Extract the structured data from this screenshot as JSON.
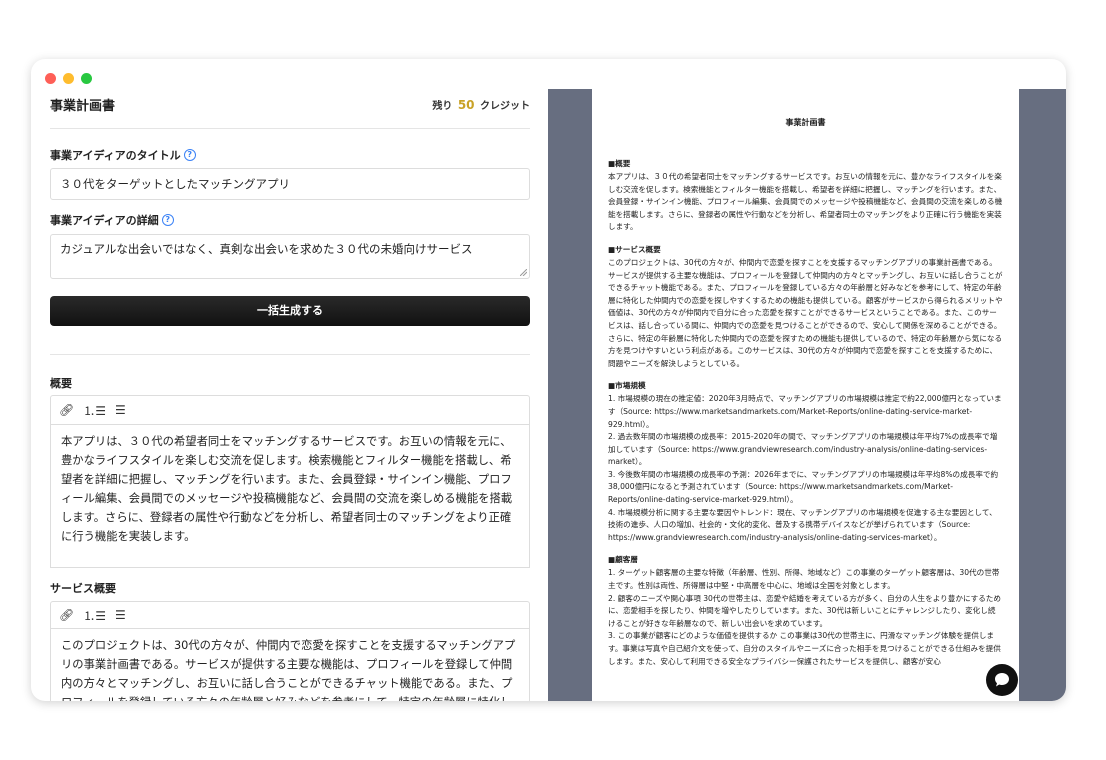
{
  "window": {
    "colors": {
      "close": "#fe5f57",
      "minimize": "#febc2e",
      "maximize": "#28c840"
    }
  },
  "header": {
    "title": "事業計画書",
    "credits_prefix": "残り",
    "credits_value": "50",
    "credits_suffix": "クレジット"
  },
  "form": {
    "title_label": "事業アイディアのタイトル",
    "title_value": "３０代をターゲットとしたマッチングアプリ",
    "detail_label": "事業アイディアの詳細",
    "detail_value": "カジュアルな出会いではなく、真剣な出会いを求めた３０代の未婚向けサービス",
    "generate_button": "一括生成する"
  },
  "sections": [
    {
      "label": "概要",
      "text": "本アプリは、３０代の希望者同士をマッチングするサービスです。お互いの情報を元に、豊かなライフスタイルを楽しむ交流を促します。検索機能とフィルター機能を搭載し、希望者を詳細に把握し、マッチングを行います。また、会員登録・サインイン機能、プロフィール編集、会員間でのメッセージや投稿機能など、会員間の交流を楽しめる機能を搭載します。さらに、登録者の属性や行動などを分析し、希望者同士のマッチングをより正確に行う機能を実装します。"
    },
    {
      "label": "サービス概要",
      "text": "このプロジェクトは、30代の方々が、仲間内で恋愛を探すことを支援するマッチングアプリの事業計画書である。サービスが提供する主要な機能は、プロフィールを登録して仲間内の方々とマッチングし、お互いに話し合うことができるチャット機能である。また、プロフィールを登録している方々の年齢層と好みなどを参考にして、特定の年齢層に特化した仲間内での恋愛を探しやすくするための機"
    }
  ],
  "toolbar": {
    "icons": [
      "link-icon",
      "ordered-list-icon",
      "bullet-list-icon"
    ]
  },
  "document": {
    "title": "事業計画書",
    "sections": [
      {
        "heading": "■概要",
        "body": "本アプリは、３０代の希望者同士をマッチングするサービスです。お互いの情報を元に、豊かなライフスタイルを楽しむ交流を促します。検索機能とフィルター機能を搭載し、希望者を詳細に把握し、マッチングを行います。また、会員登録・サインイン機能、プロフィール編集、会員間でのメッセージや投稿機能など、会員間の交流を楽しめる機能を搭載します。さらに、登録者の属性や行動などを分析し、希望者同士のマッチングをより正確に行う機能を実装します。"
      },
      {
        "heading": "■サービス概要",
        "body": "このプロジェクトは、30代の方々が、仲間内で恋愛を探すことを支援するマッチングアプリの事業計画書である。サービスが提供する主要な機能は、プロフィールを登録して仲間内の方々とマッチングし、お互いに話し合うことができるチャット機能である。また、プロフィールを登録している方々の年齢層と好みなどを参考にして、特定の年齢層に特化した仲間内での恋愛を探しやすくするための機能も提供している。顧客がサービスから得られるメリットや価値は、30代の方々が仲間内で自分に合った恋愛を探すことができるサービスということである。また、このサービスは、話し合っている間に、仲間内での恋愛を見つけることができるので、安心して関係を深めることができる。さらに、特定の年齢層に特化した仲間内での恋愛を探すための機能も提供しているので、特定の年齢層から気になる方を見つけやすいという利点がある。このサービスは、30代の方々が仲間内で恋愛を探すことを支援するために、問題やニーズを解決しようとしている。"
      },
      {
        "heading": "■市場規模",
        "body": "1. 市場規模の現在の推定値：2020年3月時点で、マッチングアプリの市場規模は推定で約22,000億円となっています（Source: https://www.marketsandmarkets.com/Market-Reports/online-dating-service-market-929.html）。\n2. 過去数年間の市場規模の成長率：2015-2020年の間で、マッチングアプリの市場規模は年平均7%の成長率で増加しています（Source: https://www.grandviewresearch.com/industry-analysis/online-dating-services-market）。\n3. 今後数年間の市場規模の成長率の予測：2026年までに、マッチングアプリの市場規模は年平均8%の成長率で約38,000億円になると予測されています（Source: https://www.marketsandmarkets.com/Market-Reports/online-dating-service-market-929.html）。\n4. 市場規模分析に関する主要な要因やトレンド：現在、マッチングアプリの市場規模を促進する主な要因として、技術の進歩、人口の増加、社会的・文化的変化、普及する携帯デバイスなどが挙げられています（Source: https://www.grandviewresearch.com/industry-analysis/online-dating-services-market）。"
      },
      {
        "heading": "■顧客層",
        "body": "1. ターゲット顧客層の主要な特徴（年齢層、性別、所得、地域など）この事業のターゲット顧客層は、30代の世帯主です。性別は両性、所得層は中堅・中高層を中心に、地域は全国を対象とします。\n2. 顧客のニーズや関心事項 30代の世帯主は、恋愛や結婚を考えている方が多く、自分の人生をより豊かにするために、恋愛相手を探したり、仲間を増やしたりしています。また、30代は新しいことにチャレンジしたり、変化し続けることが好きな年齢層なので、新しい出会いを求めています。\n3. この事業が顧客にどのような価値を提供するか この事業は30代の世帯主に、円滑なマッチング体験を提供します。事業は写真や自己紹介文を使って、自分のスタイルやニーズに合った相手を見つけることができる仕組みを提供します。また、安心して利用できる安全なプライバシー保護されたサービスを提供し、顧客が安心"
      }
    ]
  }
}
